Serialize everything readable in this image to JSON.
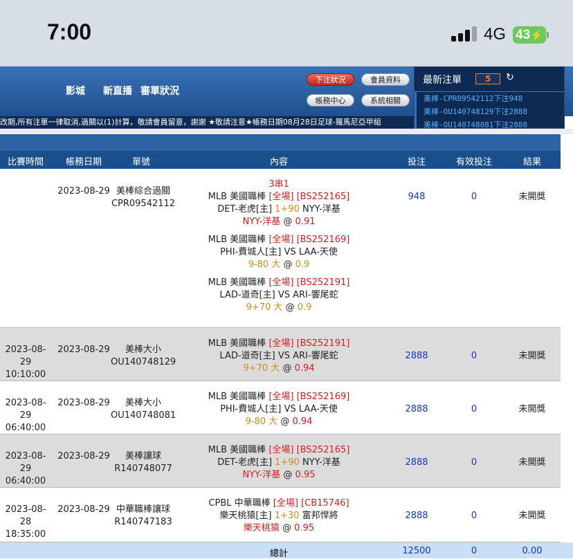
{
  "status_bar": {
    "time": "7:00",
    "network": "4G",
    "battery": "43"
  },
  "header": {
    "nav": [
      "影城",
      "新直播",
      "審單狀況"
    ],
    "buttons": {
      "bet_status": "下注狀況",
      "member_info": "會員資料",
      "account_center": "帳務中心",
      "system": "系統相關"
    }
  },
  "latest_bets": {
    "title": "最新注單",
    "count": "5",
    "refresh_icon": "↻",
    "items": [
      "美棒-CPR09542112下注948",
      "美棒-OU140748129下注2888",
      "美棒-OU140748081下注2888"
    ]
  },
  "marquee": "改期,所有注單一律取消,過關以(1)計算，敬請會員留意，謝謝 ★敬請注意★帳務日期08月28日足球-羅馬尼亞甲組",
  "table": {
    "headers": [
      "比賽時間",
      "帳務日期",
      "單號",
      "內容",
      "投注",
      "有效投注",
      "結果"
    ],
    "rows": [
      {
        "time": [
          "",
          ""
        ],
        "date": "2023-08-29",
        "bet": [
          "美棒綜合過關",
          "CPR09542112"
        ],
        "parlay": "3串1",
        "legs": [
          {
            "league": "MLB 美國職棒",
            "tag": "[全場] [BS252165]",
            "home": "DET-老虎[主]",
            "line": "1+90",
            "away": "NYY-洋基",
            "pick": "NYY-洋基",
            "at": "@",
            "odds": "0.91"
          },
          {
            "league": "MLB 美國職棒",
            "tag": "[全場] [BS252169]",
            "home": "PHI-費城人[主]",
            "line": "VS",
            "away": "LAA-天使",
            "pick": "9-80 大",
            "at": "@",
            "odds": "0.9"
          },
          {
            "league": "MLB 美國職棒",
            "tag": "[全場] [BS252191]",
            "home": "LAD-道奇[主]",
            "line": "VS",
            "away": "ARI-響尾蛇",
            "pick": "9+70 大",
            "at": "@",
            "odds": "0.9"
          }
        ],
        "amount": "948",
        "valid": "0",
        "result": "未開獎"
      },
      {
        "time": [
          "2023-08-29",
          "10:10:00"
        ],
        "date": "2023-08-29",
        "bet": [
          "美棒大小",
          "OU140748129"
        ],
        "legs": [
          {
            "league": "MLB 美國職棒",
            "tag": "[全場] [BS252191]",
            "home": "LAD-道奇[主]",
            "line": "VS",
            "away": "ARI-響尾蛇",
            "pick": "9+70 大",
            "at": "@",
            "odds": "0.94"
          }
        ],
        "amount": "2888",
        "valid": "0",
        "result": "未開獎"
      },
      {
        "time": [
          "2023-08-29",
          "06:40:00"
        ],
        "date": "2023-08-29",
        "bet": [
          "美棒大小",
          "OU140748081"
        ],
        "legs": [
          {
            "league": "MLB 美國職棒",
            "tag": "[全場] [BS252169]",
            "home": "PHI-費城人[主]",
            "line": "VS",
            "away": "LAA-天使",
            "pick": "9-80 大",
            "at": "@",
            "odds": "0.94"
          }
        ],
        "amount": "2888",
        "valid": "0",
        "result": "未開獎"
      },
      {
        "time": [
          "2023-08-29",
          "06:40:00"
        ],
        "date": "2023-08-29",
        "bet": [
          "美棒讓球",
          "R140748077"
        ],
        "legs": [
          {
            "league": "MLB 美國職棒",
            "tag": "[全場] [BS252165]",
            "home": "DET-老虎[主]",
            "line": "1+90",
            "away": "NYY-洋基",
            "pick": "NYY-洋基",
            "at": "@",
            "odds": "0.95"
          }
        ],
        "amount": "2888",
        "valid": "0",
        "result": "未開獎"
      },
      {
        "time": [
          "2023-08-28",
          "18:35:00"
        ],
        "date": "2023-08-29",
        "bet": [
          "中華職棒讓球",
          "R140747183"
        ],
        "legs": [
          {
            "league": "CPBL 中華職棒",
            "tag": "[全場] [CB15746]",
            "home": "樂天桃猿[主]",
            "line": "1+30",
            "away": "富邦悍將",
            "pick": "樂天桃猿",
            "at": "@",
            "odds": "0.95"
          }
        ],
        "amount": "2888",
        "valid": "0",
        "result": "未開獎"
      }
    ],
    "total": {
      "label": "總計",
      "amount": "12500",
      "valid": "0",
      "result": "0.00"
    }
  }
}
